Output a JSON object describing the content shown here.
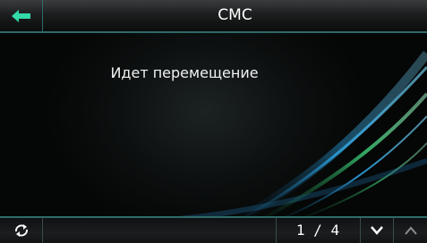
{
  "header": {
    "title": "СМС",
    "back_icon": "arrow-left-icon"
  },
  "main": {
    "message": "Идет перемещение"
  },
  "footer": {
    "refresh_icon": "refresh-icon",
    "page_indicator": "1 / 4",
    "next_icon": "chevron-down-icon",
    "prev_icon": "chevron-up-icon"
  },
  "colors": {
    "accent": "#2f6b6a",
    "back_arrow": "#33d9a6",
    "text": "#ffffff"
  }
}
